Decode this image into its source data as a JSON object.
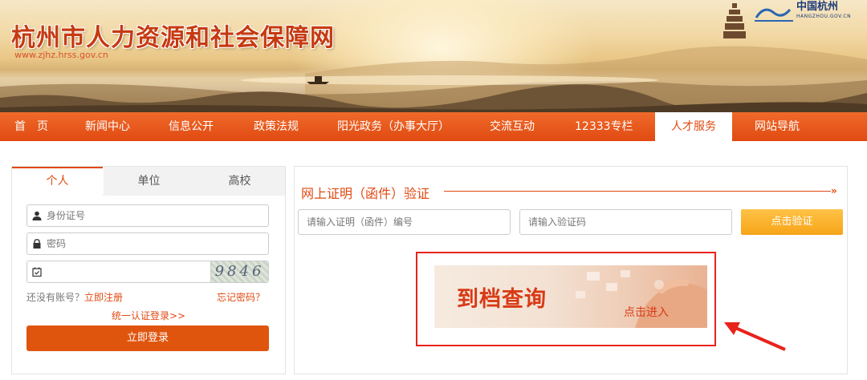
{
  "header": {
    "site_title": "杭州市人力资源和社会保障网",
    "site_url": "www.zjhz.hrss.gov.cn",
    "city_logo_cn": "中国杭州",
    "city_logo_en": "HANGZHOU.GOV.CN"
  },
  "nav": {
    "items": [
      {
        "label": "首　页"
      },
      {
        "label": "新闻中心"
      },
      {
        "label": "信息公开"
      },
      {
        "label": "政策法规"
      },
      {
        "label": "阳光政务（办事大厅）"
      },
      {
        "label": "交流互动"
      },
      {
        "label": "12333专栏"
      },
      {
        "label": "人才服务",
        "active": true
      },
      {
        "label": "网站导航"
      }
    ]
  },
  "login": {
    "tabs": [
      {
        "label": "个人",
        "active": true
      },
      {
        "label": "单位"
      },
      {
        "label": "高校"
      }
    ],
    "id_placeholder": "身份证号",
    "password_placeholder": "密码",
    "captcha_text": "9846",
    "no_account_text": "还没有账号？",
    "register_link": "立即注册",
    "forgot_link": "忘记密码？",
    "unified_login_link": "统一认证登录>>",
    "login_button": "立即登录"
  },
  "verify": {
    "title": "网上证明（函件）验证",
    "arrow": "»",
    "cert_placeholder": "请输入证明（函件）编号",
    "code_placeholder": "请输入验证码",
    "button": "点击验证"
  },
  "promo": {
    "title": "到档查询",
    "enter_text": "点击进入"
  },
  "colors": {
    "brand_orange": "#e04a12",
    "nav_bg": "#f06a2a",
    "highlight_red": "#e8231b",
    "verify_button": "#f6a418"
  }
}
